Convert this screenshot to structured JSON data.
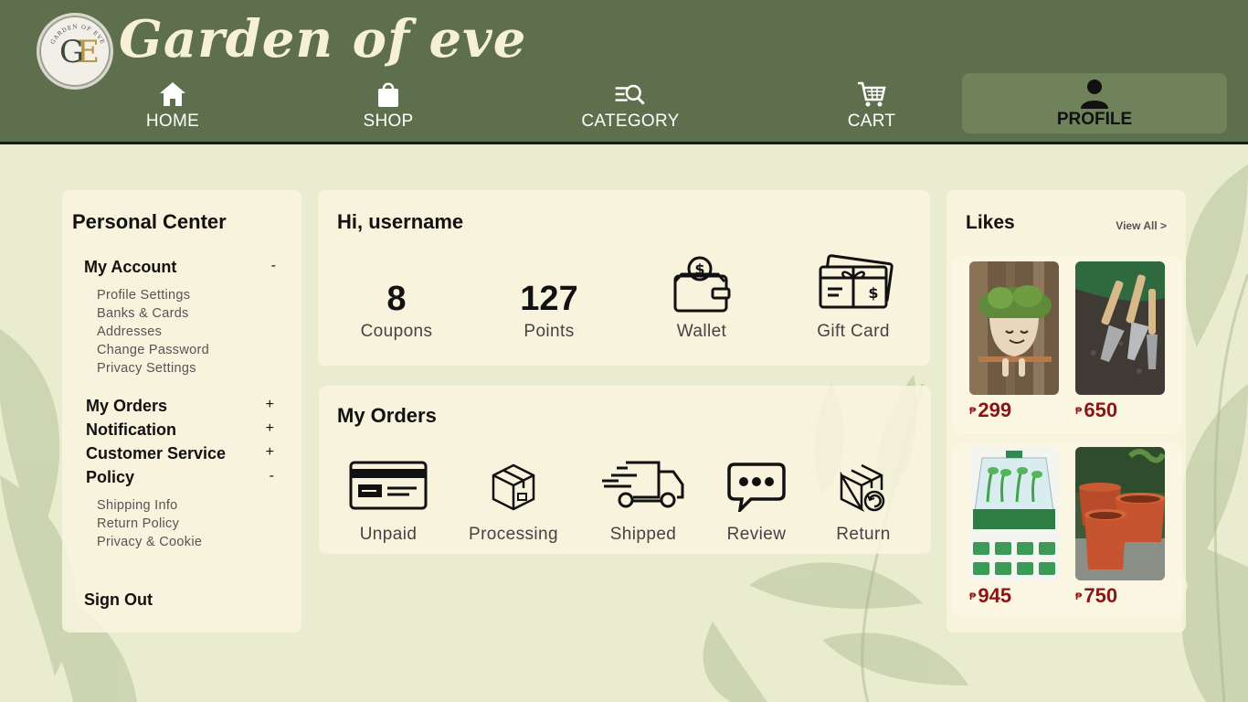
{
  "brand": {
    "name": "Garden of eve",
    "logo_monogram": "GE",
    "logo_ring_text": "GARDEN OF EVE"
  },
  "nav": [
    {
      "label": "HOME",
      "icon": "home-icon"
    },
    {
      "label": "SHOP",
      "icon": "shopping-bag-icon"
    },
    {
      "label": "CATEGORY",
      "icon": "category-search-icon"
    },
    {
      "label": "CART",
      "icon": "cart-icon"
    },
    {
      "label": "PROFILE",
      "icon": "user-icon",
      "active": true
    }
  ],
  "personal_center": {
    "title": "Personal Center",
    "sections": [
      {
        "label": "My Account",
        "toggle": "-",
        "items": [
          "Profile Settings",
          "Banks & Cards",
          "Addresses",
          "Change Password",
          "Privacy Settings"
        ]
      },
      {
        "label": "My Orders",
        "toggle": "+"
      },
      {
        "label": "Notification",
        "toggle": "+"
      },
      {
        "label": "Customer Service",
        "toggle": "+"
      },
      {
        "label": "Policy",
        "toggle": "-",
        "items": [
          "Shipping Info",
          "Return Policy",
          "Privacy & Cookie"
        ]
      }
    ],
    "sign_out": "Sign Out"
  },
  "greeting": {
    "title": "Hi, username",
    "stats": [
      {
        "value": "8",
        "label": "Coupons"
      },
      {
        "value": "127",
        "label": "Points"
      },
      {
        "label": "Wallet",
        "icon": "wallet-icon"
      },
      {
        "label": "Gift Card",
        "icon": "gift-card-icon"
      }
    ]
  },
  "orders": {
    "title": "My Orders",
    "items": [
      {
        "label": "Unpaid",
        "icon": "credit-card-icon"
      },
      {
        "label": "Processing",
        "icon": "package-icon"
      },
      {
        "label": "Shipped",
        "icon": "truck-icon"
      },
      {
        "label": "Review",
        "icon": "chat-bubble-icon"
      },
      {
        "label": "Return",
        "icon": "return-package-icon"
      }
    ]
  },
  "likes": {
    "title": "Likes",
    "view_all": "View All >",
    "currency": "₱",
    "products": [
      {
        "price": "299",
        "image": "smiley-planter"
      },
      {
        "price": "650",
        "image": "garden-tools"
      },
      {
        "price": "945",
        "image": "seed-tray"
      },
      {
        "price": "750",
        "image": "terracotta-pots"
      }
    ]
  },
  "colors": {
    "header": "#5e6f4e",
    "profile_active": "#6f8259",
    "background": "#eaeccf",
    "price": "#8b1414"
  }
}
